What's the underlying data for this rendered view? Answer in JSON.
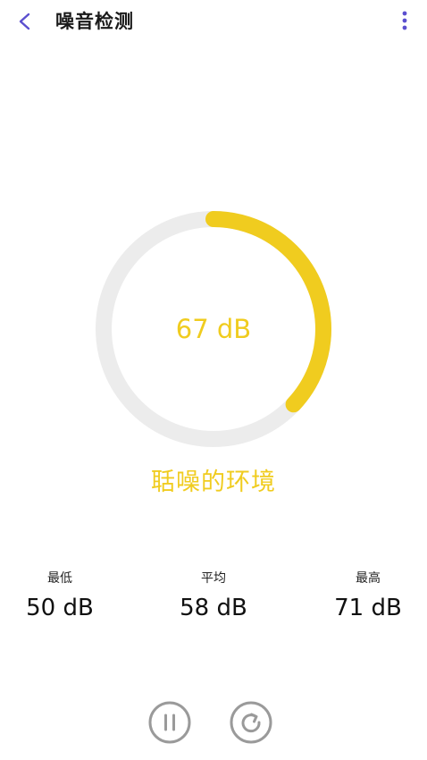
{
  "header": {
    "title": "噪音检测",
    "back_icon": "chevron-left-icon",
    "more_icon": "more-vertical-icon"
  },
  "gauge": {
    "value_text": "67 dB",
    "level": 67,
    "progress_fraction": 0.37,
    "environment_label": "聒噪的环境"
  },
  "stats": {
    "min": {
      "label": "最低",
      "value": "50 dB"
    },
    "avg": {
      "label": "平均",
      "value": "58 dB"
    },
    "max": {
      "label": "最高",
      "value": "71 dB"
    }
  },
  "controls": {
    "pause_icon": "pause-icon",
    "reset_icon": "refresh-icon"
  },
  "colors": {
    "accent": "#f0cc1f",
    "track": "#ececec",
    "back_icon": "#5b4fcf",
    "control_icon": "#9a9a9a"
  }
}
